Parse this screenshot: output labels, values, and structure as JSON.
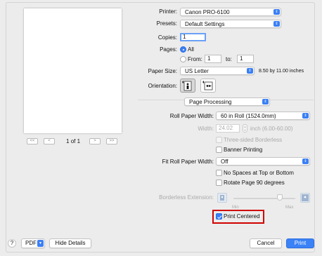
{
  "preview": {
    "page_current": "1",
    "page_sep": "of",
    "page_total": "1"
  },
  "pager": {
    "first": "<<",
    "prev": "<",
    "next": ">",
    "last": ">>"
  },
  "printer": {
    "label": "Printer:",
    "value": "Canon PRO-6100"
  },
  "presets": {
    "label": "Presets:",
    "value": "Default Settings"
  },
  "copies": {
    "label": "Copies:",
    "value": "1"
  },
  "pages": {
    "label": "Pages:",
    "all_label": "All",
    "selected": "All",
    "from_label": "From:",
    "from_value": "1",
    "to_label": "to:",
    "to_value": "1"
  },
  "paper_size": {
    "label": "Paper Size:",
    "value": "US Letter",
    "dimensions": "8.50 by 11.00 inches"
  },
  "orientation": {
    "label": "Orientation:",
    "selected": "portrait"
  },
  "section": {
    "value": "Page Processing"
  },
  "roll_paper_width": {
    "label": "Roll Paper Width:",
    "value": "60 in Roll (1524.0mm)"
  },
  "width": {
    "label": "Width:",
    "value": "24.02",
    "unit_range": "inch (6.00-60.00)"
  },
  "three_sided_borderless": {
    "label": "Three-sided Borderless",
    "checked": false,
    "enabled": false
  },
  "banner_printing": {
    "label": "Banner Printing",
    "checked": false
  },
  "fit_roll_paper_width": {
    "label": "Fit Roll Paper Width:",
    "value": "Off"
  },
  "no_spaces": {
    "label": "No Spaces at Top or Bottom",
    "checked": false
  },
  "rotate_90": {
    "label": "Rotate Page 90 degrees",
    "checked": false
  },
  "borderless_extension": {
    "label": "Borderless Extension:",
    "min_label": "Min",
    "max_label": "Max",
    "level": 0.75,
    "enabled": false
  },
  "print_centered": {
    "label": "Print Centered",
    "checked": true
  },
  "footer": {
    "help": "?",
    "pdf_label": "PDF",
    "hide_details": "Hide Details",
    "cancel": "Cancel",
    "print": "Print"
  },
  "colors": {
    "accent": "#3b7ff5",
    "highlight": "#d00000",
    "background": "#ececec"
  }
}
